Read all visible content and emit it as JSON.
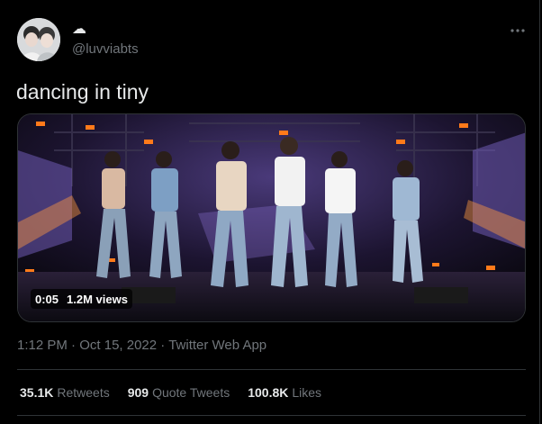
{
  "author": {
    "display_name": "☁",
    "username": "@luvviabts"
  },
  "tweet": {
    "text": "dancing in tiny"
  },
  "video": {
    "duration": "0:05",
    "views": "1.2M views"
  },
  "meta": {
    "time": "1:12 PM",
    "dot1": "·",
    "date": "Oct 15, 2022",
    "dot2": "·",
    "source": "Twitter Web App"
  },
  "stats": {
    "retweets_count": "35.1K",
    "retweets_label": "Retweets",
    "quotes_count": "909",
    "quotes_label": "Quote Tweets",
    "likes_count": "100.8K",
    "likes_label": "Likes"
  },
  "colors": {
    "background": "#000000",
    "text": "#e7e9ea",
    "secondary_text": "#71767b",
    "divider": "#2f3336"
  },
  "icons": {
    "more": "more-horizontal-icon",
    "display_name": "cloud-emoji"
  }
}
